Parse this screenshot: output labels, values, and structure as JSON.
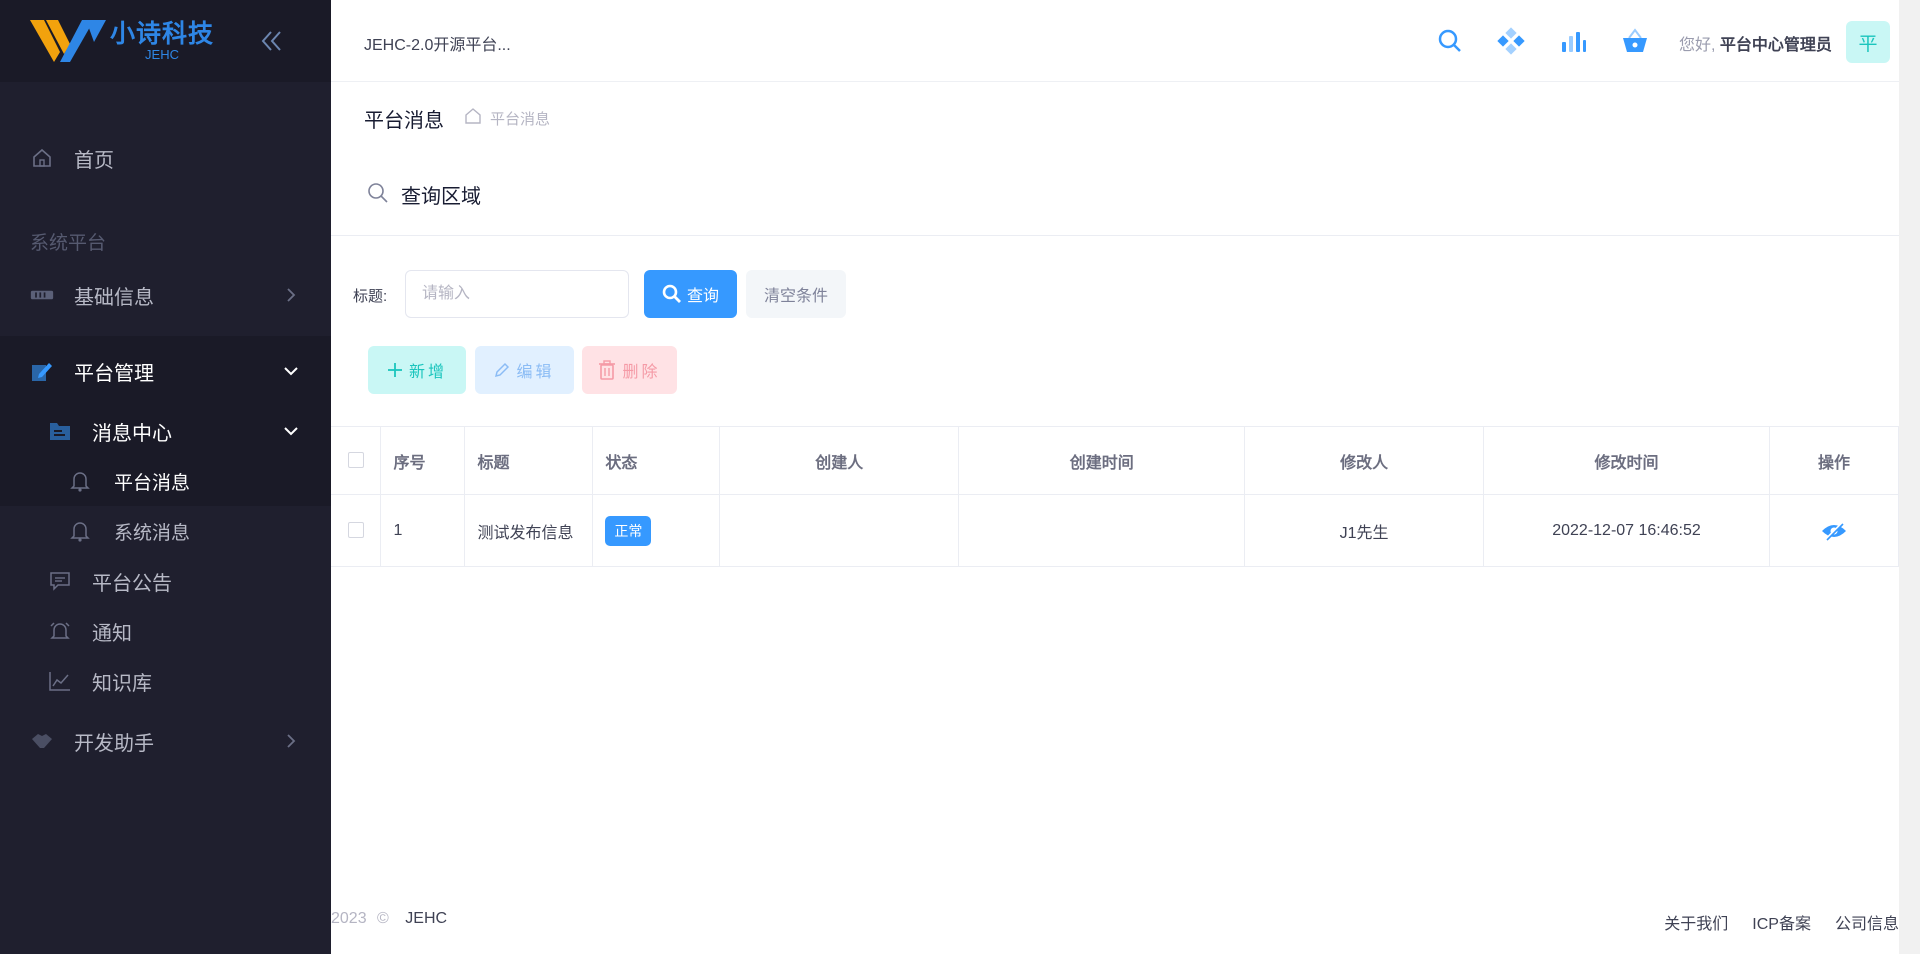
{
  "sidebar": {
    "logo_title": "小诗科技",
    "logo_sub": "JEHC",
    "items": {
      "home": "首页",
      "group": "系统平台",
      "basic": "基础信息",
      "platform_mgmt": "平台管理",
      "msg_center": "消息中心",
      "platform_msg": "平台消息",
      "system_msg": "系统消息",
      "notice": "平台公告",
      "notify": "通知",
      "knowledge": "知识库",
      "dev": "开发助手"
    }
  },
  "header": {
    "project": "JEHC-2.0开源平台...",
    "greeting_prefix": "您好,",
    "user": "平台中心管理员",
    "avatar": "平"
  },
  "subheader": {
    "title": "平台消息",
    "crumb": "平台消息"
  },
  "query": {
    "title": "查询区域",
    "label": "标题:",
    "placeholder": "请输入",
    "search_btn": "查询",
    "clear_btn": "清空条件"
  },
  "toolbar": {
    "add": "新增",
    "edit": "编辑",
    "delete": "删除"
  },
  "table": {
    "columns": [
      "序号",
      "标题",
      "状态",
      "创建人",
      "创建时间",
      "修改人",
      "修改时间",
      "操作"
    ],
    "rows": [
      {
        "no": "1",
        "title": "测试发布信息",
        "status": "正常",
        "creator": "",
        "created": "",
        "modifier": "J1先生",
        "modified": "2022-12-07 16:46:52"
      }
    ]
  },
  "footer": {
    "year": "2023",
    "copy": "©",
    "brand": "JEHC",
    "links": [
      "关于我们",
      "ICP备案",
      "公司信息"
    ]
  },
  "colors": {
    "primary": "#3699ff",
    "success": "#1bc5bd",
    "danger": "#f64e60",
    "sidebar": "#1f1f2e"
  }
}
